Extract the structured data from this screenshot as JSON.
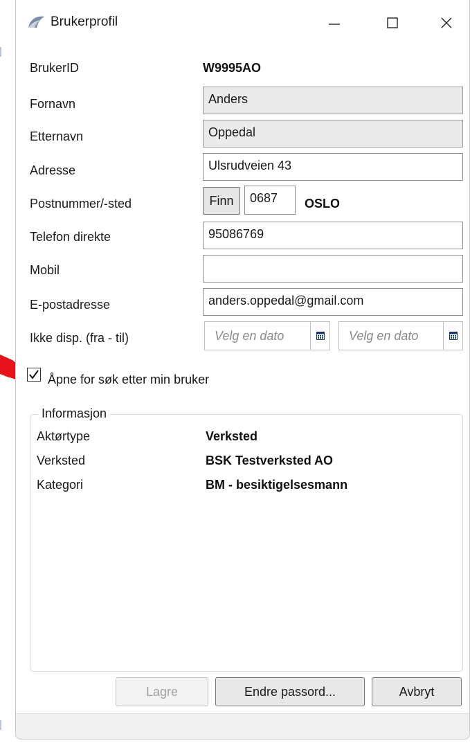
{
  "window": {
    "title": "Brukerprofil"
  },
  "form": {
    "brukerid": {
      "label": "BrukerID",
      "value": "W9995AO"
    },
    "fornavn": {
      "label": "Fornavn",
      "value": "Anders"
    },
    "etternavn": {
      "label": "Etternavn",
      "value": "Oppedal"
    },
    "adresse": {
      "label": "Adresse",
      "value": "Ulsrudveien 43"
    },
    "postnummer": {
      "label": "Postnummer/-sted",
      "finn_label": "Finn",
      "value": "0687",
      "sted": "OSLO"
    },
    "telefon": {
      "label": "Telefon direkte",
      "value": "95086769"
    },
    "mobil": {
      "label": "Mobil",
      "value": ""
    },
    "epost": {
      "label": "E-postadresse",
      "value": "anders.oppedal@gmail.com"
    },
    "ikke_disp": {
      "label": "Ikke disp. (fra - til)",
      "from_placeholder": "Velg en dato",
      "to_placeholder": "Velg en dato"
    },
    "apne_sok": {
      "label": "Åpne for søk etter min bruker",
      "checked": true
    }
  },
  "informasjon": {
    "legend": "Informasjon",
    "rows": [
      {
        "label": "Aktørtype",
        "value": "Verksted"
      },
      {
        "label": "Verksted",
        "value": "BSK Testverksted AO"
      },
      {
        "label": "Kategori",
        "value": "BM - besiktigelsesmann"
      }
    ]
  },
  "buttons": {
    "lagre": "Lagre",
    "endre_passord": "Endre passord...",
    "avbryt": "Avbryt"
  },
  "colors": {
    "annotation_arrow": "#e8141c",
    "readonly_bg": "#ebebeb",
    "button_bg": "#e8e8e8"
  }
}
